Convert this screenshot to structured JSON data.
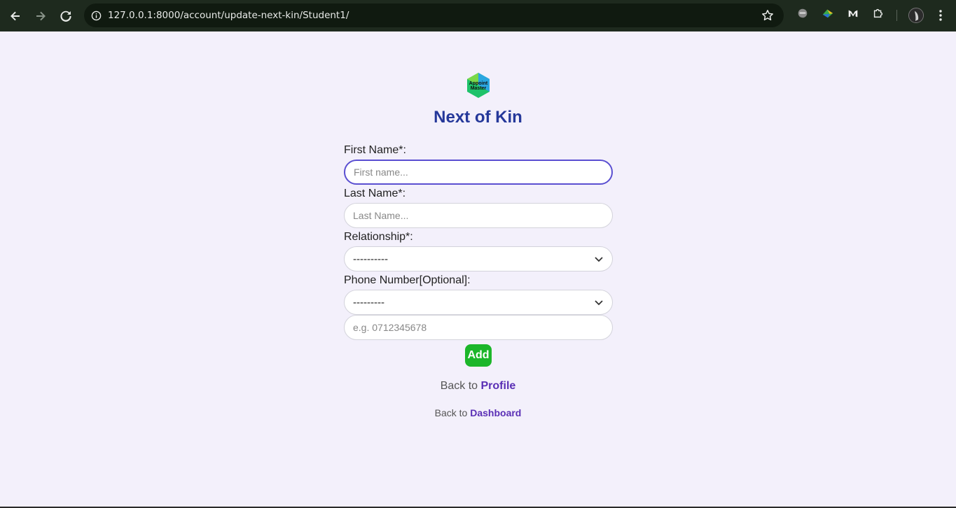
{
  "browser": {
    "url": "127.0.0.1:8000/account/update-next-kin/Student1/"
  },
  "page": {
    "logo_text_top": "Appoint",
    "logo_text_bottom": "Master",
    "title": "Next of Kin"
  },
  "form": {
    "first_name_label": "First Name*:",
    "first_name_placeholder": "First name...",
    "last_name_label": "Last Name*:",
    "last_name_placeholder": "Last Name...",
    "relationship_label": "Relationship*:",
    "relationship_value": "----------",
    "phone_label": "Phone Number[Optional]:",
    "phone_code_value": "---------",
    "phone_placeholder": "e.g. 0712345678",
    "add_label": "Add"
  },
  "links": {
    "back_to_1": "Back to ",
    "profile": "Profile",
    "back_to_2": "Back to ",
    "dashboard": "Dashboard"
  },
  "colors": {
    "title": "#25389a",
    "add_button": "#1cb62a",
    "link": "#5a2fb5",
    "focus_border": "#5a4fd1"
  }
}
